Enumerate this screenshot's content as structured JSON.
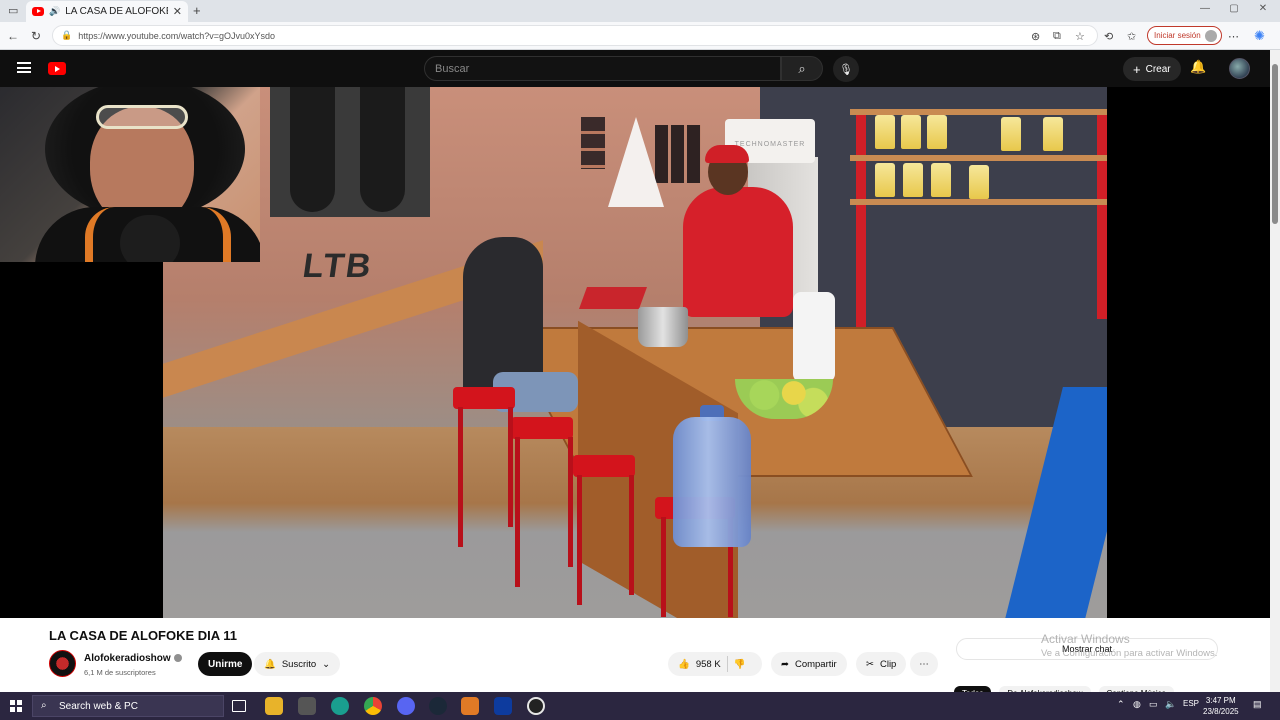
{
  "browser": {
    "tab_title": "LA CASA DE ALOFOKE DIA 11",
    "url": "https://www.youtube.com/watch?v=gOJvu0xYsdo",
    "sign_in_label": "Iniciar sesión"
  },
  "youtube": {
    "search_placeholder": "Buscar",
    "create_label": "Crear"
  },
  "video": {
    "title": "LA CASA DE ALOFOKE DIA 11",
    "overlay_text": "LTB",
    "sign_text": "TECHNOMASTER"
  },
  "channel": {
    "name": "Alofokeradioshow",
    "subscribers": "6,1 M de suscriptores",
    "join_label": "Unirme",
    "subscribed_label": "Suscrito"
  },
  "actions": {
    "likes": "958 K",
    "share_label": "Compartir",
    "clip_label": "Clip"
  },
  "chat": {
    "show_chat_label": "Mostrar chat"
  },
  "chips": [
    "Todos",
    "De Alofokeradioshow",
    "Contiene Música"
  ],
  "watermark": {
    "line1": "Activar Windows",
    "line2": "Ve a Configuración para activar Windows."
  },
  "taskbar": {
    "search_placeholder": "Search web & PC",
    "language": "ESP",
    "time": "3:47 PM",
    "date": "23/8/2025"
  },
  "colors": {
    "youtube_red": "#ff0000",
    "yt_dark": "#0f0f0f",
    "taskbar": "#2b2640"
  }
}
